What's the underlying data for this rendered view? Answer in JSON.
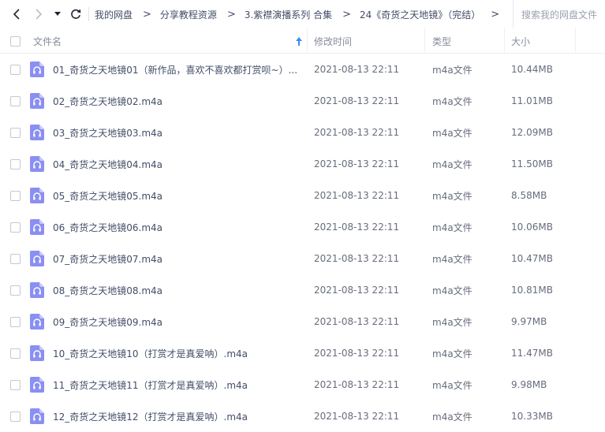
{
  "nav": {
    "back_icon": "chevron-left-icon",
    "forward_icon": "chevron-right-icon",
    "dropdown_icon": "caret-down-icon",
    "refresh_icon": "refresh-icon"
  },
  "breadcrumb": [
    {
      "label": "我的网盘"
    },
    {
      "label": "分享教程资源"
    },
    {
      "label": "3.紫襟演播系列 合集"
    },
    {
      "label": "24《奇货之天地镜》（完结）"
    }
  ],
  "breadcrumb_separator": ">",
  "search": {
    "placeholder": "搜索我的网盘文件"
  },
  "columns": {
    "name": "文件名",
    "modified": "修改时间",
    "type": "类型",
    "size": "大小"
  },
  "sort_icon": "sort-up-arrow-icon",
  "file_icon": "audio-file-icon",
  "colors": {
    "accent": "#7a7ef0",
    "text": "#424e67",
    "header_text": "#878c9c"
  },
  "files": [
    {
      "name": "01_奇货之天地镜01（新作品，喜欢不喜欢都打赏呗~）....",
      "modified": "2021-08-13 22:11",
      "type": "m4a文件",
      "size": "10.44MB"
    },
    {
      "name": "02_奇货之天地镜02.m4a",
      "modified": "2021-08-13 22:11",
      "type": "m4a文件",
      "size": "11.01MB"
    },
    {
      "name": "03_奇货之天地镜03.m4a",
      "modified": "2021-08-13 22:11",
      "type": "m4a文件",
      "size": "12.09MB"
    },
    {
      "name": "04_奇货之天地镜04.m4a",
      "modified": "2021-08-13 22:11",
      "type": "m4a文件",
      "size": "11.50MB"
    },
    {
      "name": "05_奇货之天地镜05.m4a",
      "modified": "2021-08-13 22:11",
      "type": "m4a文件",
      "size": "8.58MB"
    },
    {
      "name": "06_奇货之天地镜06.m4a",
      "modified": "2021-08-13 22:11",
      "type": "m4a文件",
      "size": "10.06MB"
    },
    {
      "name": "07_奇货之天地镜07.m4a",
      "modified": "2021-08-13 22:11",
      "type": "m4a文件",
      "size": "10.47MB"
    },
    {
      "name": "08_奇货之天地镜08.m4a",
      "modified": "2021-08-13 22:11",
      "type": "m4a文件",
      "size": "10.81MB"
    },
    {
      "name": "09_奇货之天地镜09.m4a",
      "modified": "2021-08-13 22:11",
      "type": "m4a文件",
      "size": "9.97MB"
    },
    {
      "name": "10_奇货之天地镜10（打赏才是真爱呐）.m4a",
      "modified": "2021-08-13 22:11",
      "type": "m4a文件",
      "size": "11.47MB"
    },
    {
      "name": "11_奇货之天地镜11（打赏才是真爱呐）.m4a",
      "modified": "2021-08-13 22:11",
      "type": "m4a文件",
      "size": "9.98MB"
    },
    {
      "name": "12_奇货之天地镜12（打赏才是真爱呐）.m4a",
      "modified": "2021-08-13 22:11",
      "type": "m4a文件",
      "size": "10.33MB"
    }
  ]
}
